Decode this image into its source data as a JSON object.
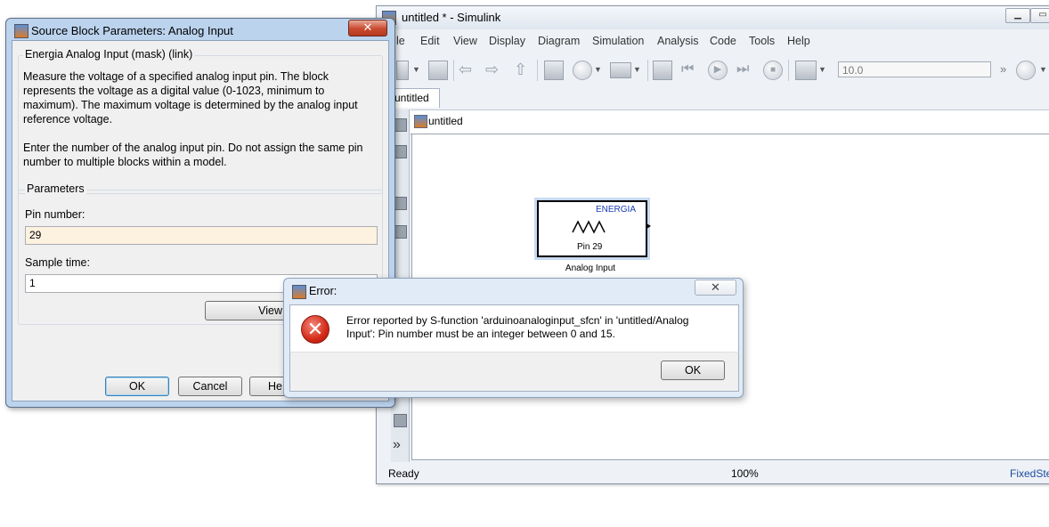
{
  "simulink": {
    "title": "untitled * - Simulink",
    "menu": [
      "le",
      "Edit",
      "View",
      "Display",
      "Diagram",
      "Simulation",
      "Analysis",
      "Code",
      "Tools",
      "Help"
    ],
    "stop_time": "10.0",
    "tab": "untitled",
    "address": "untitled",
    "block": {
      "brand": "ENERGIA",
      "pin_label": "Pin 29",
      "name": "Analog Input"
    },
    "status": {
      "ready": "Ready",
      "zoom": "100%",
      "solver": "FixedSte"
    }
  },
  "block_params": {
    "title": "Source Block Parameters: Analog Input",
    "group_title": "Energia Analog Input (mask) (link)",
    "description_1": "Measure the voltage of a specified analog input pin. The block represents the voltage as a digital value (0-1023, minimum to maximum). The maximum voltage is determined by the analog input reference voltage.",
    "description_2": "Enter the number of the analog input pin. Do not assign the same pin number to multiple blocks within a model.",
    "params_title": "Parameters",
    "pin_number_label": "Pin number:",
    "pin_number_value": "29",
    "sample_time_label": "Sample time:",
    "sample_time_value": "1",
    "view_button": "View",
    "ok_button": "OK",
    "cancel_button": "Cancel",
    "help_button": "He"
  },
  "error_dialog": {
    "title": "Error:",
    "message": "Error reported by S-function 'arduinoanaloginput_sfcn' in 'untitled/Analog Input': Pin number must be an integer between 0 and 15.",
    "ok_button": "OK",
    "close_glyph": "✕"
  },
  "icons": [
    "close-icon",
    "error-icon",
    "save-icon",
    "back-arrow-icon",
    "forward-arrow-icon",
    "up-arrow-icon",
    "library-browser-icon",
    "gear-icon",
    "run-icon",
    "step-back-icon",
    "step-forward-icon",
    "stop-icon",
    "scope-icon",
    "minimize-icon",
    "maximize-icon",
    "model-icon",
    "sine-wave-icon",
    "more-chevron-icon"
  ]
}
